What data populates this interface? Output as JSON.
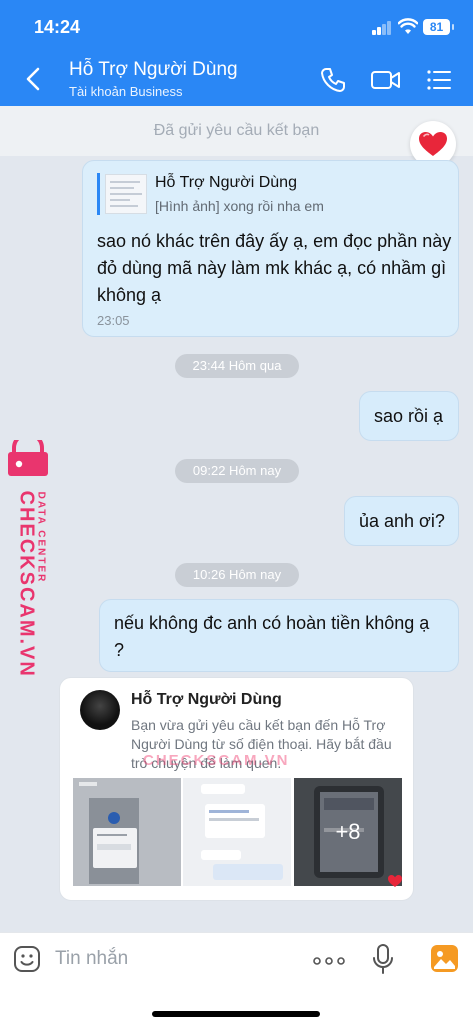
{
  "status": {
    "time": "14:24",
    "battery": "81"
  },
  "header": {
    "title": "Hỗ Trợ Người Dùng",
    "subtitle": "Tài khoản Business"
  },
  "friend_request_bar": "Đã gửi yêu cầu kết bạn",
  "quote_message": {
    "quoted_name": "Hỗ Trợ Người Dùng",
    "quoted_snippet": "[Hình ảnh] xong rồi nha em",
    "text": "sao nó khác trên đây ấy ạ, em đọc phần này đỏ dùng mã này làm mk khác ạ, có nhầm gì không ạ",
    "time": "23:05"
  },
  "dividers": [
    "23:44 Hôm qua",
    "09:22 Hôm nay",
    "10:26 Hôm nay"
  ],
  "messages": [
    "sao rồi ạ",
    "ủa anh ơi?",
    "nếu không đc anh có hoàn tiền không ạ ?"
  ],
  "friend_card": {
    "name": "Hỗ Trợ Người Dùng",
    "text": "Bạn vừa gửi yêu cầu kết bạn đến Hỗ Trợ Người Dùng từ số điện thoại. Hãy bắt đầu trò chuyện để làm quen.",
    "more_count": "+8"
  },
  "watermark": {
    "side_big": "CHECKSCAM.VN",
    "side_small": "DATA CENTER",
    "center": "CHECKSCAM.VN"
  },
  "input": {
    "placeholder": "Tin nhắn"
  },
  "colors": {
    "header": "#2a87f5",
    "bubble": "#d7ecfb",
    "chat_bg": "#e2e7ee"
  },
  "icons": [
    "back-icon",
    "phone-icon",
    "video-call-icon",
    "menu-icon",
    "heart-icon",
    "emoji-icon",
    "more-icon",
    "mic-icon",
    "photo-icon"
  ]
}
